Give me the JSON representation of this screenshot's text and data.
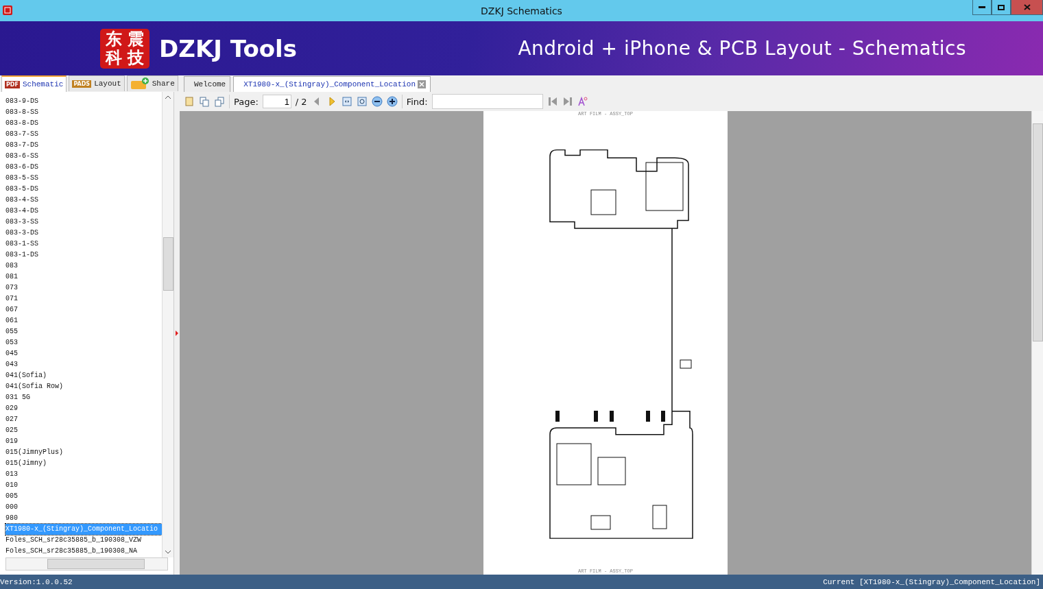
{
  "window": {
    "title": "DZKJ Schematics"
  },
  "banner": {
    "logo_chars": [
      "东",
      "震",
      "科",
      "技"
    ],
    "brand": "DZKJ Tools",
    "tagline": "Android + iPhone & PCB Layout - Schematics"
  },
  "side_tabs": [
    {
      "label": "Schematic",
      "badge": "PDF",
      "selected": true
    },
    {
      "label": "Layout",
      "badge": "PADS",
      "selected": false
    },
    {
      "label": "Share",
      "selected": false
    }
  ],
  "doc_tabs": [
    {
      "label": "Welcome",
      "selected": false,
      "closable": false
    },
    {
      "label": "XT1980-x_(Stingray)_Component_Location",
      "selected": true,
      "closable": true
    }
  ],
  "file_list": [
    {
      "name": "083-9-DS",
      "selected": false
    },
    {
      "name": "083-8-SS",
      "selected": false
    },
    {
      "name": "083-8-DS",
      "selected": false
    },
    {
      "name": "083-7-SS",
      "selected": false
    },
    {
      "name": "083-7-DS",
      "selected": false
    },
    {
      "name": "083-6-SS",
      "selected": false
    },
    {
      "name": "083-6-DS",
      "selected": false
    },
    {
      "name": "083-5-SS",
      "selected": false
    },
    {
      "name": "083-5-DS",
      "selected": false
    },
    {
      "name": "083-4-SS",
      "selected": false
    },
    {
      "name": "083-4-DS",
      "selected": false
    },
    {
      "name": "083-3-SS",
      "selected": false
    },
    {
      "name": "083-3-DS",
      "selected": false
    },
    {
      "name": "083-1-SS",
      "selected": false
    },
    {
      "name": "083-1-DS",
      "selected": false
    },
    {
      "name": "083",
      "selected": false
    },
    {
      "name": "081",
      "selected": false
    },
    {
      "name": "073",
      "selected": false
    },
    {
      "name": "071",
      "selected": false
    },
    {
      "name": "067",
      "selected": false
    },
    {
      "name": "061",
      "selected": false
    },
    {
      "name": "055",
      "selected": false
    },
    {
      "name": "053",
      "selected": false
    },
    {
      "name": "045",
      "selected": false
    },
    {
      "name": "043",
      "selected": false
    },
    {
      "name": "041(Sofia)",
      "selected": false
    },
    {
      "name": "041(Sofia Row)",
      "selected": false
    },
    {
      "name": "031 5G",
      "selected": false
    },
    {
      "name": "029",
      "selected": false
    },
    {
      "name": "027",
      "selected": false
    },
    {
      "name": "025",
      "selected": false
    },
    {
      "name": "019",
      "selected": false
    },
    {
      "name": "015(JimnyPlus)",
      "selected": false
    },
    {
      "name": "015(Jimny)",
      "selected": false
    },
    {
      "name": "013",
      "selected": false
    },
    {
      "name": "010",
      "selected": false
    },
    {
      "name": "005",
      "selected": false
    },
    {
      "name": "000",
      "selected": false
    },
    {
      "name": "980",
      "selected": false
    },
    {
      "name": "XT1980-x_(Stingray)_Component_Locatio",
      "selected": true
    },
    {
      "name": "Foles_SCH_sr28c35885_b_190308_VZW",
      "selected": false
    },
    {
      "name": "Foles_SCH_sr28c35885_b_190308_NA",
      "selected": false
    }
  ],
  "toolbar": {
    "page_label": "Page:",
    "page_value": "1",
    "page_total": "/ 2",
    "find_label": "Find:"
  },
  "document": {
    "header": "ART FILM - ASSY_TOP",
    "footer": "ART FILM - ASSY_TOP"
  },
  "status_bar": {
    "version": "Version:1.0.0.52",
    "current": "Current [XT1980-x_(Stingray)_Component_Location]"
  }
}
